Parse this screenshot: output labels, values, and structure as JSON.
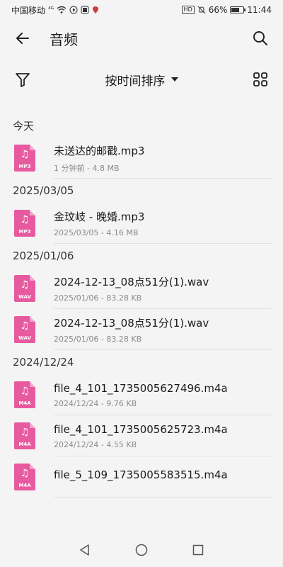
{
  "status_bar": {
    "carrier": "中国移动",
    "signal_text": "⁴ᴳ",
    "hd": "HD",
    "battery": "66%",
    "battery_level": 0.66,
    "time": "11:44"
  },
  "app_bar": {
    "title": "音频"
  },
  "sort_bar": {
    "label": "按时间排序"
  },
  "sections": [
    {
      "header": "今天",
      "items": [
        {
          "name": "未送达的邮戳.mp3",
          "meta": "1 分钟前 - 4.8 MB",
          "ext": "MP3"
        }
      ]
    },
    {
      "header": "2025/03/05",
      "items": [
        {
          "name": "金玟岐 - 晚婚.mp3",
          "meta": "2025/03/05 - 4.16 MB",
          "ext": "MP3"
        }
      ]
    },
    {
      "header": "2025/01/06",
      "items": [
        {
          "name": "2024-12-13_08点51分(1).wav",
          "meta": "2025/01/06 - 83.28 KB",
          "ext": "WAV"
        },
        {
          "name": "2024-12-13_08点51分(1).wav",
          "meta": "2025/01/06 - 83.28 KB",
          "ext": "WAV"
        }
      ]
    },
    {
      "header": "2024/12/24",
      "items": [
        {
          "name": "file_4_101_1735005627496.m4a",
          "meta": "2024/12/24 - 9.76 KB",
          "ext": "M4A"
        },
        {
          "name": "file_4_101_1735005625723.m4a",
          "meta": "2024/12/24 - 4.55 KB",
          "ext": "M4A"
        },
        {
          "name": "file_5_109_1735005583515.m4a",
          "meta": "",
          "ext": "M4A"
        }
      ]
    }
  ],
  "colors": {
    "file_icon": "#e85a9f",
    "background": "#f4f4f4"
  }
}
